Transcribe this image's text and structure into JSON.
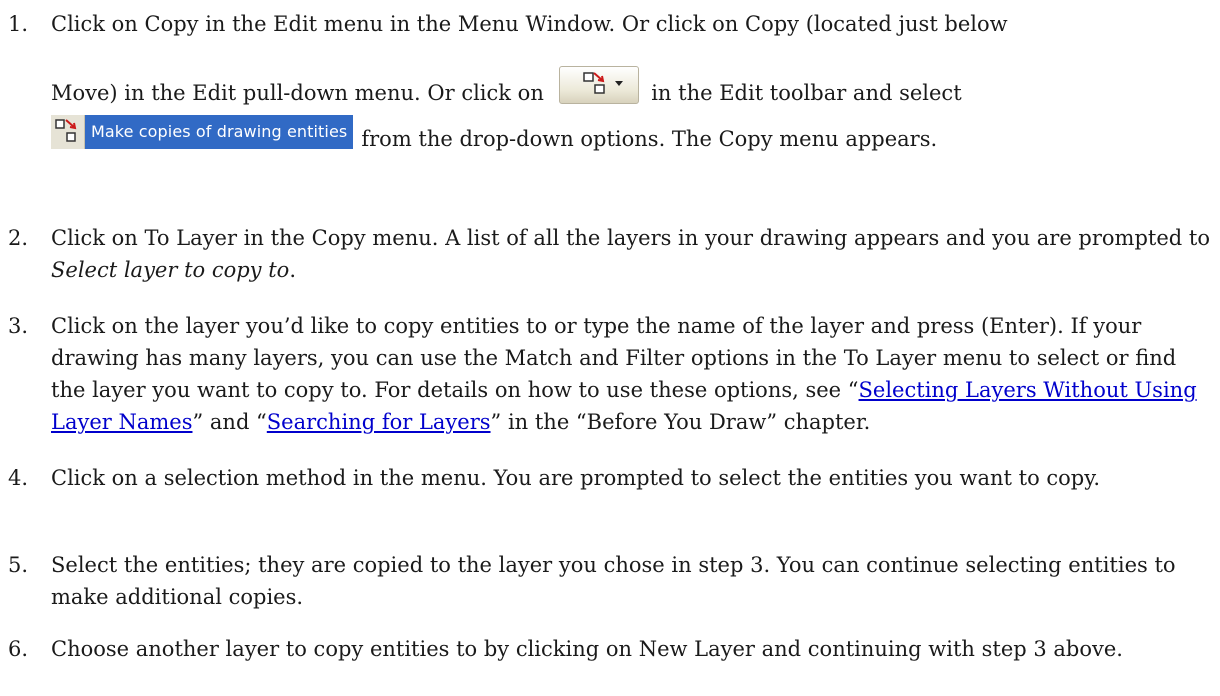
{
  "steps": [
    {
      "number": "1.",
      "line1": "Click on Copy in the Edit menu in the Menu Window. Or click on Copy (located just below",
      "line2_a": "Move) in the Edit pull-down menu. Or click on",
      "line2_b": "in the Edit toolbar and select",
      "option_label": "Make copies of drawing entities",
      "line3_b": "from the drop-down options. The Copy menu appears."
    },
    {
      "number": "2.",
      "text_a": "Click on To Layer in the Copy menu. A list of all the layers in your drawing appears and you are prompted to ",
      "text_em": "Select layer to copy to",
      "text_b": "."
    },
    {
      "number": "3.",
      "text_a": "Click on the layer you’d like to copy entities to or type the name of the layer and press (Enter). If your drawing has many layers, you can use the Match and Filter options in the To Layer menu to select or find the layer you want to copy to. For details on how to use these options, see “",
      "link1": "Selecting Layers Without Using Layer Names",
      "text_b": "” and “",
      "link2": "Searching for Layers",
      "text_c": "” in the “Before You Draw” chapter."
    },
    {
      "number": "4.",
      "text": "Click on a selection method in the menu. You are prompted to select the entities you want to copy."
    },
    {
      "number": "5.",
      "text": "Select the entities; they are copied to the layer you chose in step 3. You can continue selecting entities to make additional copies."
    },
    {
      "number": "6.",
      "text": "Choose another layer to copy entities to by clicking on New Layer and continuing with step 3 above."
    }
  ],
  "icons": {
    "toolbar_button": "copy-dropdown-icon",
    "option_icon": "copy-entities-icon"
  },
  "colors": {
    "link": "#0000cc",
    "highlight": "#316ac5"
  }
}
